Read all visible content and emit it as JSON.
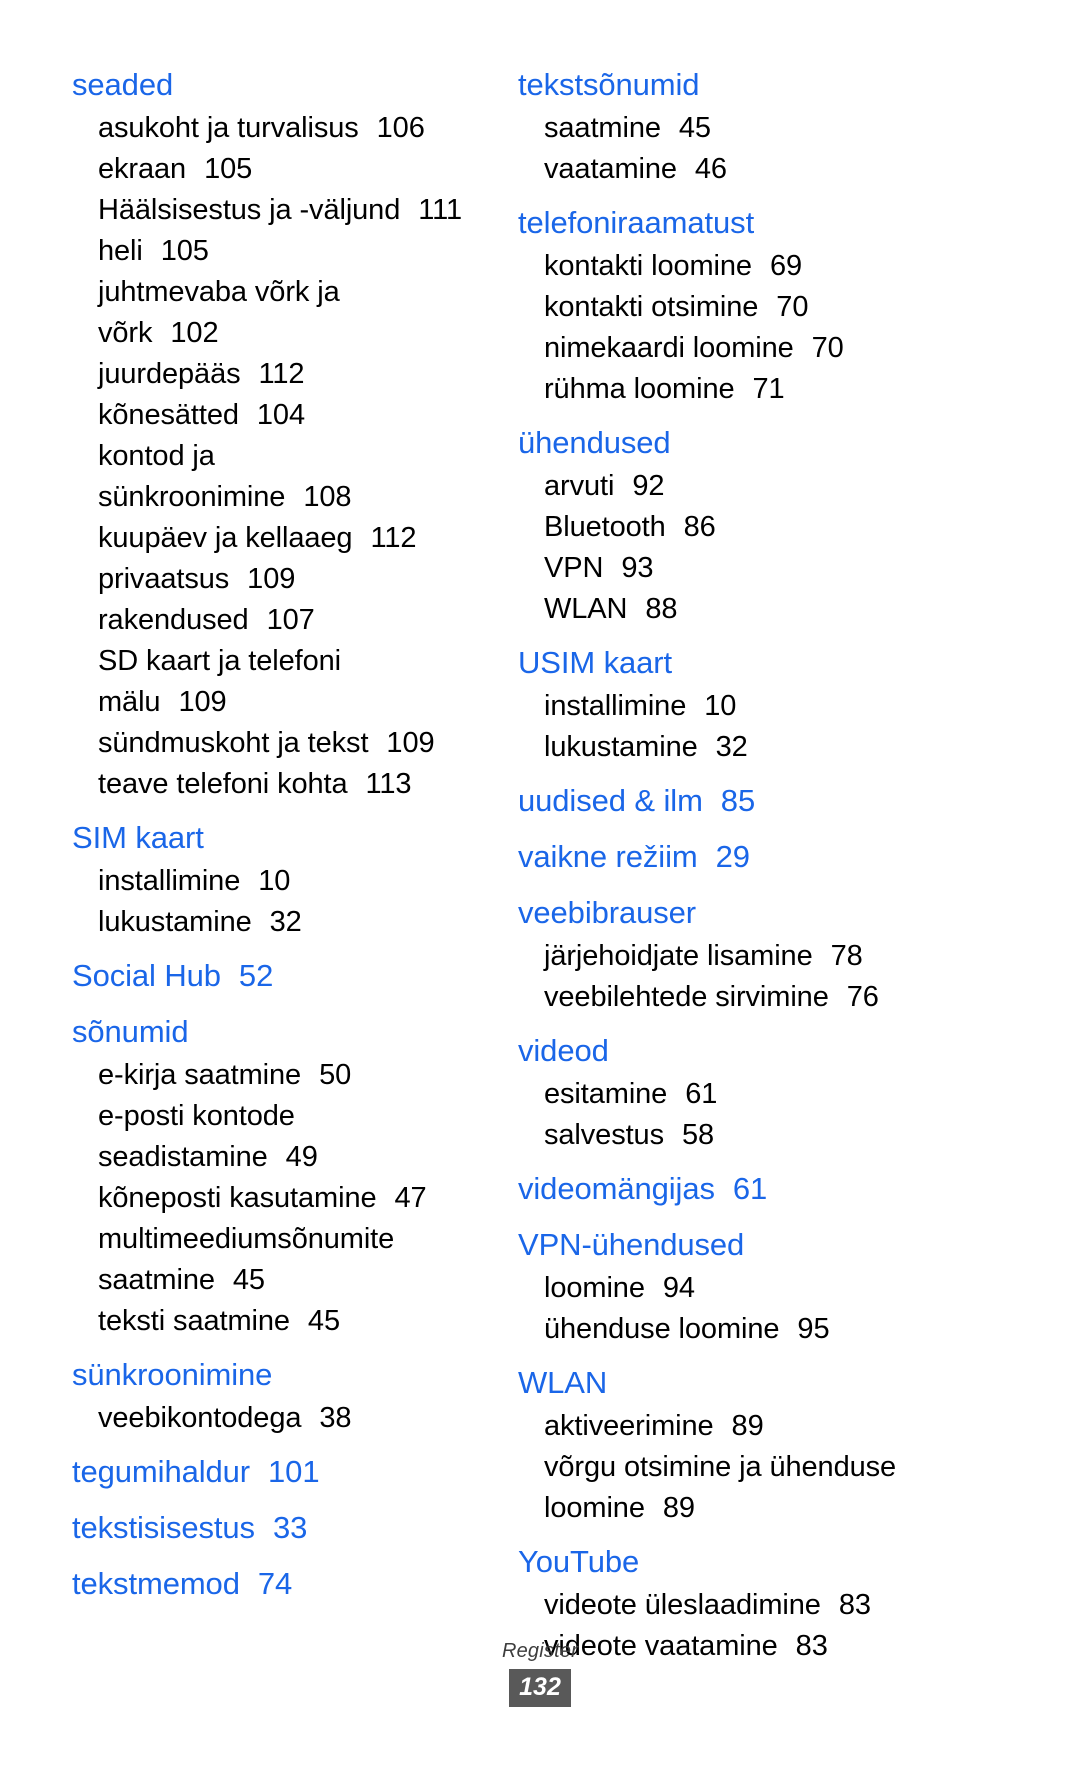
{
  "document": {
    "footer_label": "Register",
    "page_number": "132",
    "heading_color": "#1a66e8",
    "body_color": "#000000",
    "page_badge_bg": "#595959"
  },
  "left_column": [
    {
      "type": "heading",
      "label": "seaded",
      "page": "",
      "entries": [
        {
          "label": "asukoht ja turvalisus",
          "page": "106"
        },
        {
          "label": "ekraan",
          "page": "105"
        },
        {
          "label": "Häälsisestus ja -väljund",
          "page": "111"
        },
        {
          "label": "heli",
          "page": "105"
        },
        {
          "label": "juhtmevaba võrk ja",
          "page": ""
        },
        {
          "label": "võrk",
          "page": "102"
        },
        {
          "label": "juurdepääs",
          "page": "112"
        },
        {
          "label": "kõnesätted",
          "page": "104"
        },
        {
          "label": "kontod ja",
          "page": ""
        },
        {
          "label": "sünkroonimine",
          "page": "108"
        },
        {
          "label": "kuupäev ja kellaaeg",
          "page": "112"
        },
        {
          "label": "privaatsus",
          "page": "109"
        },
        {
          "label": "rakendused",
          "page": "107"
        },
        {
          "label": "SD kaart ja telefoni",
          "page": ""
        },
        {
          "label": "mälu",
          "page": "109"
        },
        {
          "label": "sündmuskoht ja tekst",
          "page": "109"
        },
        {
          "label": "teave telefoni kohta",
          "page": "113"
        }
      ]
    },
    {
      "type": "heading",
      "label": "SIM kaart",
      "page": "",
      "entries": [
        {
          "label": "installimine",
          "page": "10"
        },
        {
          "label": "lukustamine",
          "page": "32"
        }
      ]
    },
    {
      "type": "heading",
      "label": "Social Hub",
      "page": "52",
      "entries": []
    },
    {
      "type": "heading",
      "label": "sõnumid",
      "page": "",
      "entries": [
        {
          "label": "e-kirja saatmine",
          "page": "50"
        },
        {
          "label": "e-posti kontode",
          "page": ""
        },
        {
          "label": "seadistamine",
          "page": "49"
        },
        {
          "label": "kõneposti kasutamine",
          "page": "47"
        },
        {
          "label": "multimeediumsõnumite",
          "page": ""
        },
        {
          "label": "saatmine",
          "page": "45"
        },
        {
          "label": "teksti saatmine",
          "page": "45"
        }
      ]
    },
    {
      "type": "heading",
      "label": "sünkroonimine",
      "page": "",
      "entries": [
        {
          "label": "veebikontodega",
          "page": "38"
        }
      ]
    },
    {
      "type": "heading",
      "label": "tegumihaldur",
      "page": "101",
      "entries": []
    },
    {
      "type": "heading",
      "label": "tekstisisestus",
      "page": "33",
      "entries": []
    },
    {
      "type": "heading",
      "label": "tekstmemod",
      "page": "74",
      "entries": []
    }
  ],
  "right_column": [
    {
      "type": "heading",
      "label": "tekstsõnumid",
      "page": "",
      "entries": [
        {
          "label": "saatmine",
          "page": "45"
        },
        {
          "label": "vaatamine",
          "page": "46"
        }
      ]
    },
    {
      "type": "heading",
      "label": "telefoniraamatust",
      "page": "",
      "entries": [
        {
          "label": "kontakti loomine",
          "page": "69"
        },
        {
          "label": "kontakti otsimine",
          "page": "70"
        },
        {
          "label": "nimekaardi loomine",
          "page": "70"
        },
        {
          "label": "rühma loomine",
          "page": "71"
        }
      ]
    },
    {
      "type": "heading",
      "label": "ühendused",
      "page": "",
      "entries": [
        {
          "label": "arvuti",
          "page": "92"
        },
        {
          "label": "Bluetooth",
          "page": "86"
        },
        {
          "label": "VPN",
          "page": "93"
        },
        {
          "label": "WLAN",
          "page": "88"
        }
      ]
    },
    {
      "type": "heading",
      "label": "USIM kaart",
      "page": "",
      "entries": [
        {
          "label": "installimine",
          "page": "10"
        },
        {
          "label": "lukustamine",
          "page": "32"
        }
      ]
    },
    {
      "type": "heading",
      "label": "uudised & ilm",
      "page": "85",
      "entries": []
    },
    {
      "type": "heading",
      "label": "vaikne režiim",
      "page": "29",
      "entries": []
    },
    {
      "type": "heading",
      "label": "veebibrauser",
      "page": "",
      "entries": [
        {
          "label": "järjehoidjate lisamine",
          "page": "78"
        },
        {
          "label": "veebilehtede sirvimine",
          "page": "76"
        }
      ]
    },
    {
      "type": "heading",
      "label": "videod",
      "page": "",
      "entries": [
        {
          "label": "esitamine",
          "page": "61"
        },
        {
          "label": "salvestus",
          "page": "58"
        }
      ]
    },
    {
      "type": "heading",
      "label": "videomängijas",
      "page": "61",
      "entries": []
    },
    {
      "type": "heading",
      "label": "VPN-ühendused",
      "page": "",
      "entries": [
        {
          "label": "loomine",
          "page": "94"
        },
        {
          "label": "ühenduse loomine",
          "page": "95"
        }
      ]
    },
    {
      "type": "heading",
      "label": "WLAN",
      "page": "",
      "entries": [
        {
          "label": "aktiveerimine",
          "page": "89"
        },
        {
          "label": "võrgu otsimine ja ühenduse",
          "page": ""
        },
        {
          "label": "loomine",
          "page": "89"
        }
      ]
    },
    {
      "type": "heading",
      "label": "YouTube",
      "page": "",
      "entries": [
        {
          "label": "videote üleslaadimine",
          "page": "83"
        },
        {
          "label": "videote vaatamine",
          "page": "83"
        }
      ]
    }
  ]
}
